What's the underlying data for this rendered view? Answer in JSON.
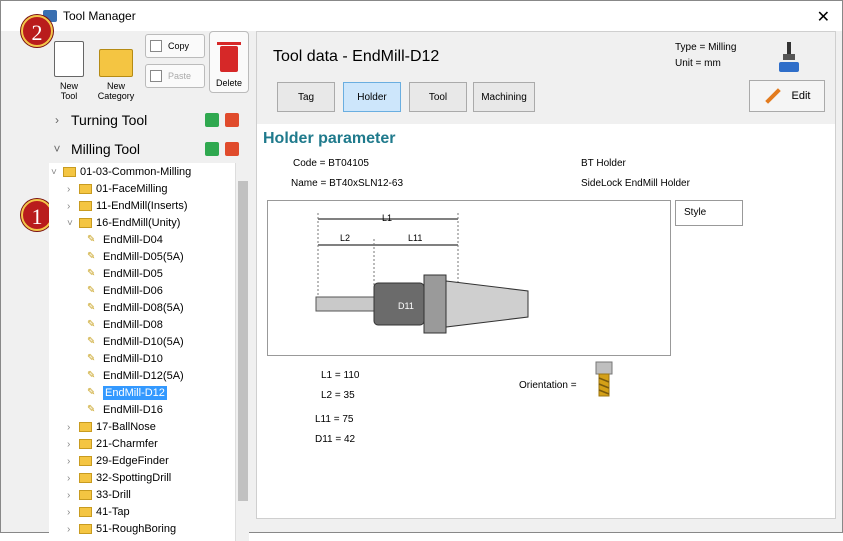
{
  "window": {
    "title": "Tool Manager"
  },
  "badges": [
    "2",
    "1"
  ],
  "toolbar": {
    "new_tool": "New\nTool",
    "new_category": "New\nCategory",
    "copy": "Copy",
    "paste": "Paste",
    "delete": "Delete"
  },
  "sections": {
    "turning": "Turning Tool",
    "milling": "Milling Tool"
  },
  "tree": {
    "root": "01-03-Common-Milling",
    "items": [
      "01-FaceMilling",
      "11-EndMill(Inserts)",
      "16-EndMill(Unity)",
      "EndMill-D04",
      "EndMill-D05(5A)",
      "EndMill-D05",
      "EndMill-D06",
      "EndMill-D08(5A)",
      "EndMill-D08",
      "EndMill-D10(5A)",
      "EndMill-D10",
      "EndMill-D12(5A)",
      "EndMill-D12",
      "EndMill-D16",
      "17-BallNose",
      "21-Charmfer",
      "29-EdgeFinder",
      "32-SpottingDrill",
      "33-Drill",
      "41-Tap",
      "51-RoughBoring"
    ]
  },
  "header": {
    "title": "Tool data - EndMill-D12",
    "type": "Type = Milling",
    "unit": "Unit = mm"
  },
  "tabs": [
    "Tag",
    "Holder",
    "Tool",
    "Machining"
  ],
  "edit_label": "Edit",
  "holder": {
    "title": "Holder parameter",
    "code": "Code = BT04105",
    "name": "Name = BT40xSLN12-63",
    "type": "BT Holder",
    "desc": "SideLock EndMill Holder",
    "style_label": "Style",
    "dims": {
      "L1": "L1",
      "L2": "L2",
      "L11": "L11",
      "D11": "D11"
    },
    "values": {
      "L1": "L1 = 110",
      "L2": "L2 = 35",
      "L11": "L11 = 75",
      "D11": "D11 = 42"
    },
    "orientation": "Orientation ="
  }
}
